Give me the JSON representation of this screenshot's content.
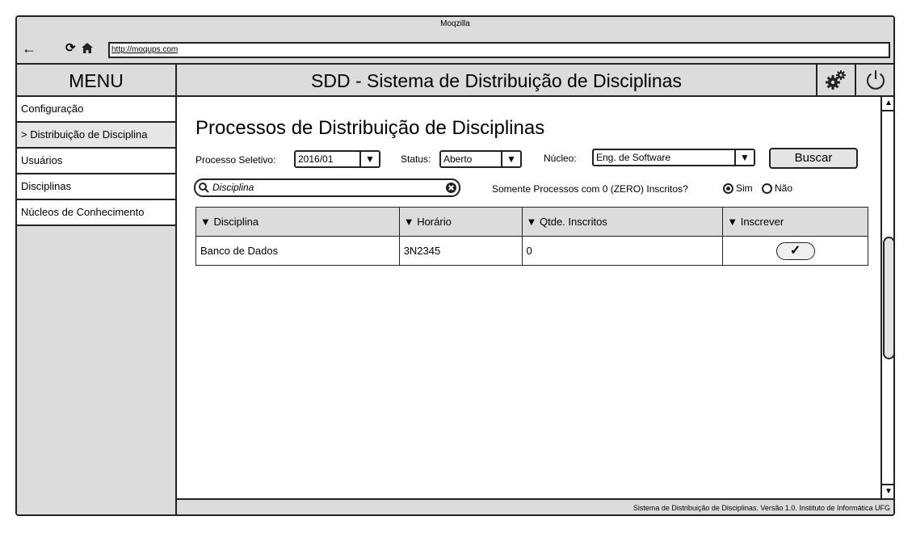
{
  "browser": {
    "title": "Moqzilla",
    "url": "http://moqups.com"
  },
  "sidebar": {
    "title": "MENU",
    "items": [
      {
        "label": "Configuração"
      },
      {
        "label": "> Distribuição de Disciplina"
      },
      {
        "label": "Usuários"
      },
      {
        "label": "Disciplinas"
      },
      {
        "label": "Núcleos de Conhecimento"
      }
    ]
  },
  "header": {
    "title": "SDD - Sistema de Distribuição de Disciplinas"
  },
  "main": {
    "title": "Processos de Distribuição de Disciplinas",
    "filters": {
      "processo_label": "Processo Seletivo:",
      "processo_value": "2016/01",
      "status_label": "Status:",
      "status_value": "Aberto",
      "nucleo_label": "Núcleo:",
      "nucleo_value": "Eng. de Software",
      "buscar_label": "Buscar",
      "search_placeholder": "Disciplina",
      "zero_label": "Somente Processos com 0 (ZERO) Inscritos?",
      "sim_label": "Sim",
      "nao_label": "Não",
      "zero_selected": "Sim"
    },
    "table": {
      "columns": [
        "Disciplina",
        "Horário",
        "Qtde. Inscritos",
        "Inscrever"
      ],
      "sort_glyph": "▼",
      "rows": [
        {
          "disciplina": "Banco de Dados",
          "horario": "3N2345",
          "inscritos": "0",
          "inscrever": "✓"
        }
      ]
    }
  },
  "footer": {
    "text": "Sistema de Distribuição de Disciplinas. Versão 1.0. Instituto de Informática UFG"
  },
  "icons": {
    "back": "back-arrow-icon",
    "reload": "reload-icon",
    "home": "home-icon",
    "settings": "gears-icon",
    "power": "power-icon",
    "search": "search-icon",
    "clear": "clear-icon"
  }
}
